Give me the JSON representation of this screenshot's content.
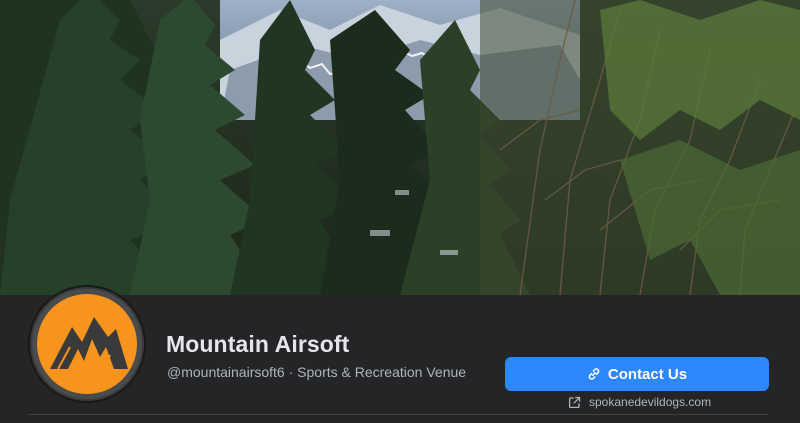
{
  "page": {
    "name": "Mountain Airsoft",
    "handle": "@mountainairsoft6",
    "separator": "·",
    "category": "Sports & Recreation Venue"
  },
  "actions": {
    "contact_label": "Contact Us",
    "contact_icon": "link-icon"
  },
  "website": {
    "url": "spokanedevildogs.com",
    "icon": "external-link-icon"
  },
  "colors": {
    "accent": "#2d88ff",
    "background": "#242526",
    "logo_orange": "#f7941d"
  }
}
